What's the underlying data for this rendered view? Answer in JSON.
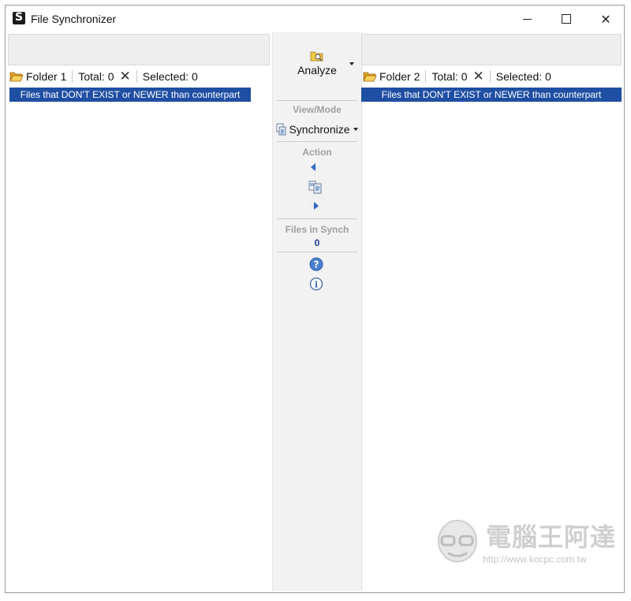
{
  "window": {
    "title": "File Synchronizer"
  },
  "left": {
    "folder_label": "Folder 1",
    "total": "Total: 0",
    "selected": "Selected: 0",
    "filter": "Files that DON'T EXIST or NEWER than counterpart"
  },
  "right": {
    "folder_label": "Folder 2",
    "total": "Total: 0",
    "selected": "Selected: 0",
    "filter": "Files that DON'T EXIST or NEWER than counterpart"
  },
  "center": {
    "analyze_label": "Analyze",
    "view_mode_label": "View/Mode",
    "mode_value": "Synchronize",
    "action_label": "Action",
    "files_in_synch_label": "Files in Synch",
    "files_in_synch_count": "0"
  },
  "watermark": {
    "title": "電腦王阿達",
    "url": "http://www.kocpc.com.tw"
  },
  "colors": {
    "filter_bar": "#1f4fa3",
    "synch_count": "#1f3aa0"
  }
}
